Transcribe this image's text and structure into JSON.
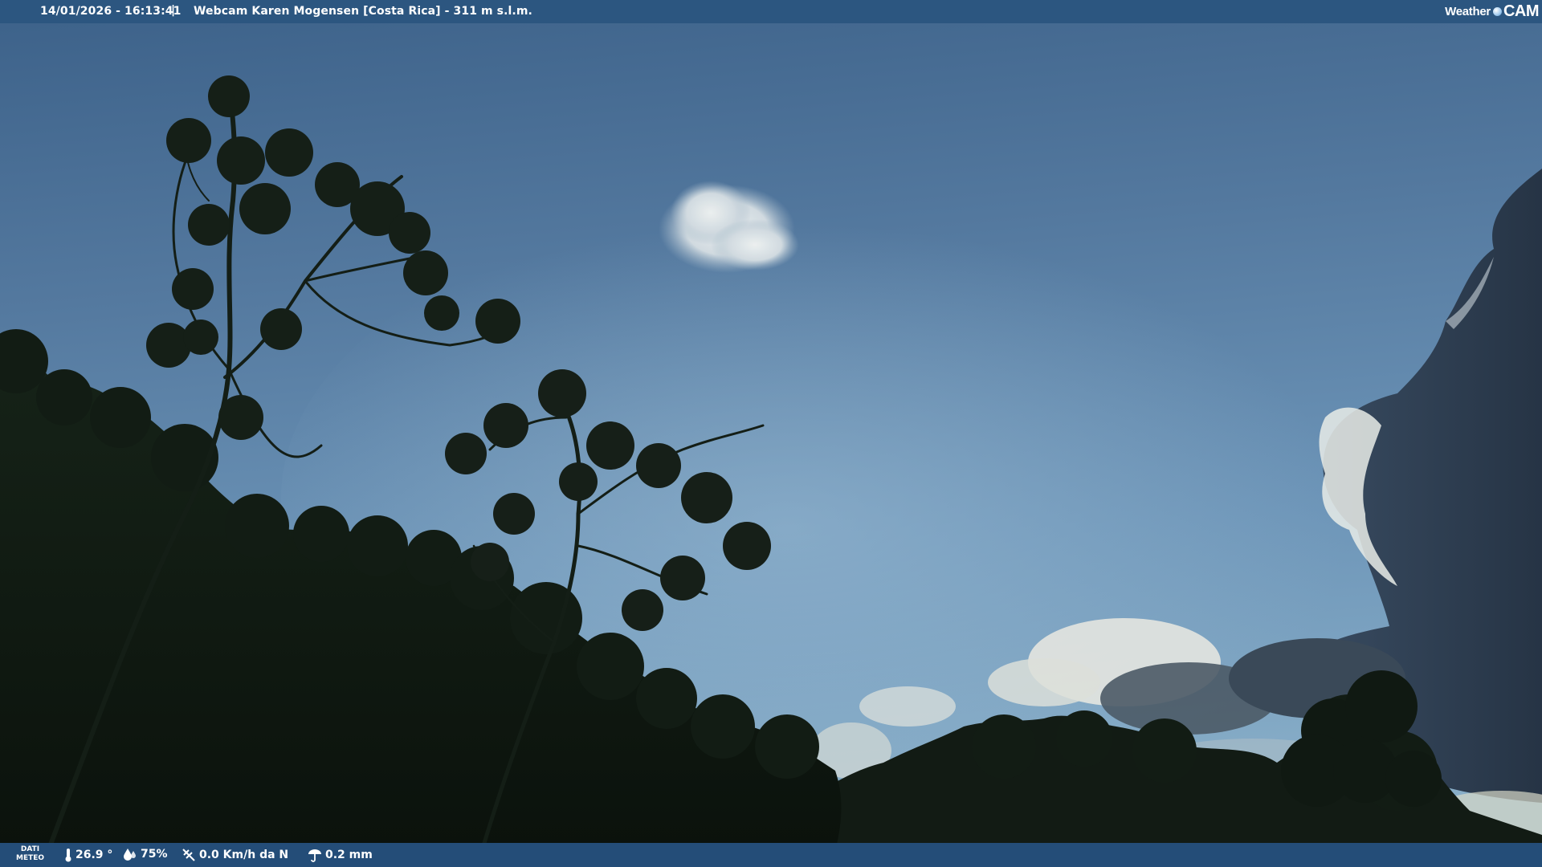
{
  "header": {
    "timestamp": "14/01/2026 - 16:13:41",
    "separator": "|",
    "title": "Webcam Karen Mogensen [Costa Rica]  - 311 m s.l.m.",
    "logo_left": "Weather",
    "logo_right": "CAM"
  },
  "footer": {
    "dati_line1": "DATI",
    "dati_line2": "METEO",
    "temperature": "26.9 °",
    "humidity": "75%",
    "wind": "0.0 Km/h da N",
    "rain": "0.2 mm",
    "icons": [
      "thermometer-icon",
      "humidity-drop-icon",
      "wind-icon",
      "rain-gauge-icon"
    ]
  },
  "colors": {
    "bar": "#2c5680",
    "sky_top": "#3f6690",
    "sky_mid": "#5d88b1",
    "sky_low": "#7fa6c4",
    "foliage": "#0f1810"
  }
}
